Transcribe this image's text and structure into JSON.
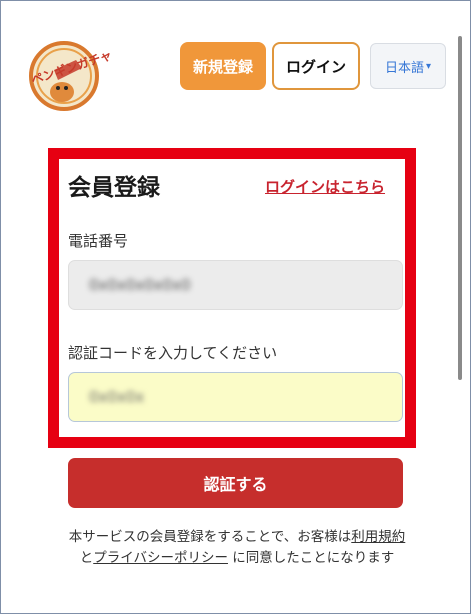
{
  "header": {
    "logo_text": "ペンギンガチャ",
    "register_label": "新規登録",
    "login_label": "ログイン",
    "language_label": "日本語",
    "language_caret": "▾"
  },
  "form": {
    "title": "会員登録",
    "login_link": "ログインはこちら",
    "phone_label": "電話番号",
    "phone_value": "0x0x0x0x0x0",
    "code_label": "認証コードを入力してください",
    "code_value": "0x0x0x",
    "submit_label": "認証する"
  },
  "terms": {
    "prefix": "本サービスの会員登録をすることで、お客様は",
    "terms_link": "利用規約",
    "middle": "と",
    "privacy_link": "プライバシーポリシー",
    "suffix": " に同意したことになります"
  },
  "colors": {
    "highlight": "#e60012",
    "primary_orange": "#f0973a",
    "submit_red": "#c62e2c",
    "link_red": "#c8232e",
    "code_field_bg": "#fbfcc8"
  }
}
